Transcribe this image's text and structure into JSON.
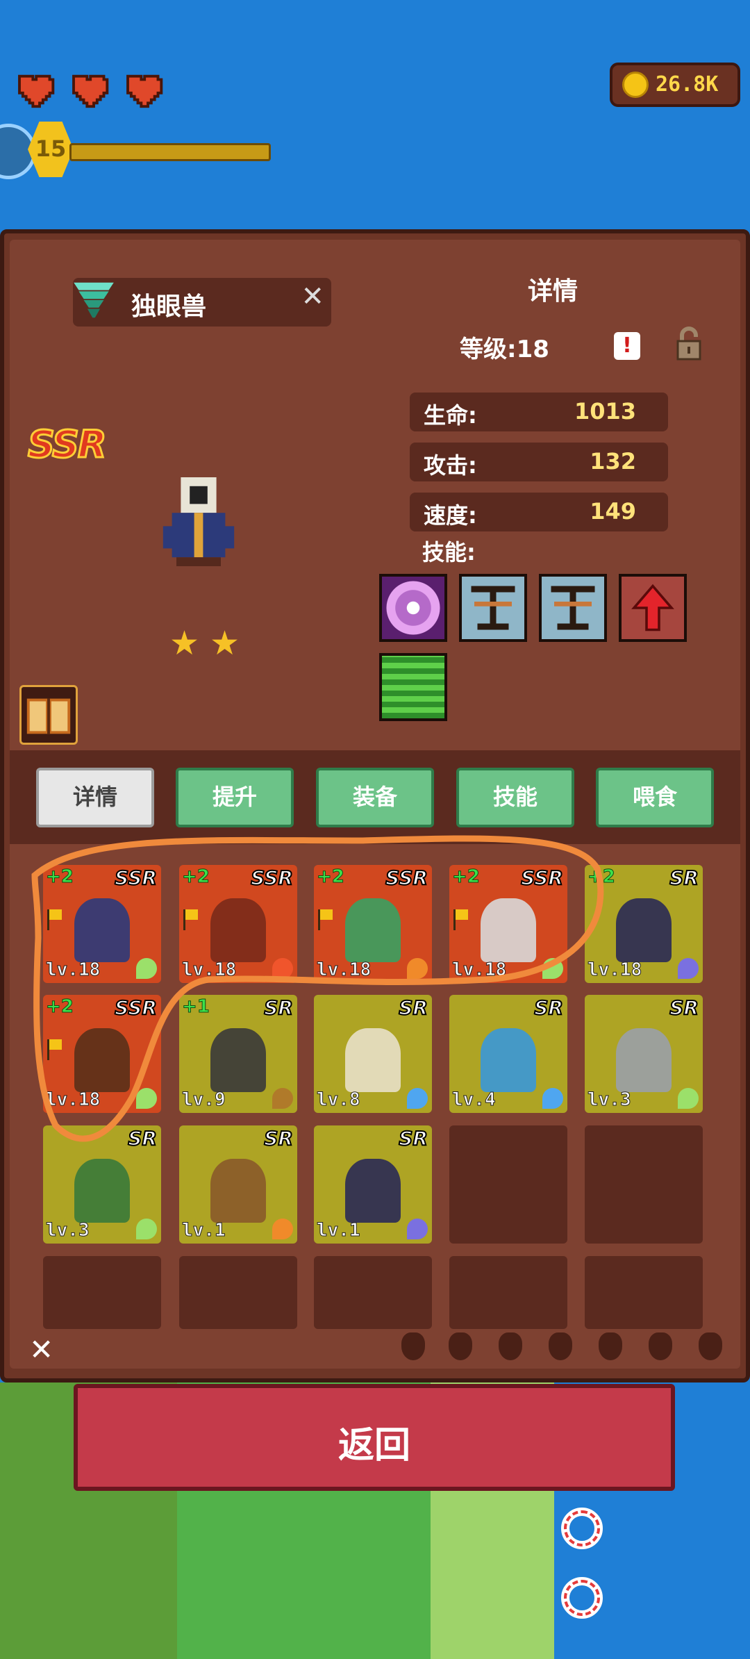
{
  "hud": {
    "hearts": 3,
    "level": "15",
    "coins": "26.8K"
  },
  "panel": {
    "monster_name": "独眼兽",
    "title": "详情",
    "level_text": "等级:18",
    "rarity": "SSR",
    "stars": 2,
    "stats": [
      {
        "label": "生命:",
        "value": "1013"
      },
      {
        "label": "攻击:",
        "value": "132"
      },
      {
        "label": "速度:",
        "value": "149"
      }
    ],
    "skills_label": "技能:",
    "skills": [
      "purple-orb-skill-icon",
      "balance-skill-icon",
      "balance-skill-icon",
      "red-arrow-up-skill-icon",
      "green-rune-skill-icon"
    ],
    "alert_icon_text": "!"
  },
  "tabs": [
    "详情",
    "提升",
    "装备",
    "技能",
    "喂食"
  ],
  "active_tab": 0,
  "cards": [
    {
      "rarity": "SSR",
      "plus": "+2",
      "level": "lv.18",
      "flag": true,
      "element": "leaf",
      "sprite": "cyclops"
    },
    {
      "rarity": "SSR",
      "plus": "+2",
      "level": "lv.18",
      "flag": true,
      "element": "fire",
      "sprite": "samurai"
    },
    {
      "rarity": "SSR",
      "plus": "+2",
      "level": "lv.18",
      "flag": true,
      "element": "sun",
      "sprite": "green-ghost"
    },
    {
      "rarity": "SSR",
      "plus": "+2",
      "level": "lv.18",
      "flag": true,
      "element": "leaf",
      "sprite": "skeleton-goblin"
    },
    {
      "rarity": "SR",
      "plus": "+2",
      "level": "lv.18",
      "flag": false,
      "element": "moon",
      "sprite": "dark-knight"
    },
    {
      "rarity": "SSR",
      "plus": "+2",
      "level": "lv.18",
      "flag": true,
      "element": "leaf",
      "sprite": "treant"
    },
    {
      "rarity": "SR",
      "plus": "+1",
      "level": "lv.9",
      "flag": false,
      "element": "earth",
      "sprite": "golem"
    },
    {
      "rarity": "SR",
      "plus": "",
      "level": "lv.8",
      "flag": false,
      "element": "water",
      "sprite": "sage"
    },
    {
      "rarity": "SR",
      "plus": "",
      "level": "lv.4",
      "flag": false,
      "element": "water",
      "sprite": "water-spirit"
    },
    {
      "rarity": "SR",
      "plus": "",
      "level": "lv.3",
      "flag": false,
      "element": "leaf",
      "sprite": "werewolf"
    },
    {
      "rarity": "SR",
      "plus": "",
      "level": "lv.3",
      "flag": false,
      "element": "leaf",
      "sprite": "orc-warrior"
    },
    {
      "rarity": "SR",
      "plus": "",
      "level": "lv.1",
      "flag": false,
      "element": "sun",
      "sprite": "deer-shaman"
    },
    {
      "rarity": "SR",
      "plus": "",
      "level": "lv.1",
      "flag": false,
      "element": "moon",
      "sprite": "dark-knight"
    }
  ],
  "empty_slots": 7,
  "filters": [
    "leaf-filter-icon",
    "earth-filter-icon",
    "water-filter-icon",
    "shield-filter-icon",
    "fire-filter-icon",
    "gear-filter-icon",
    "moon-filter-icon"
  ],
  "back_button": "返回",
  "colors": {
    "panel": "#6d3526",
    "ssr_card": "#d1481f",
    "sr_card": "#aea424",
    "tab_green": "#6cc388",
    "back_red": "#c43a4a",
    "highlight_orange": "#f08a3c"
  }
}
